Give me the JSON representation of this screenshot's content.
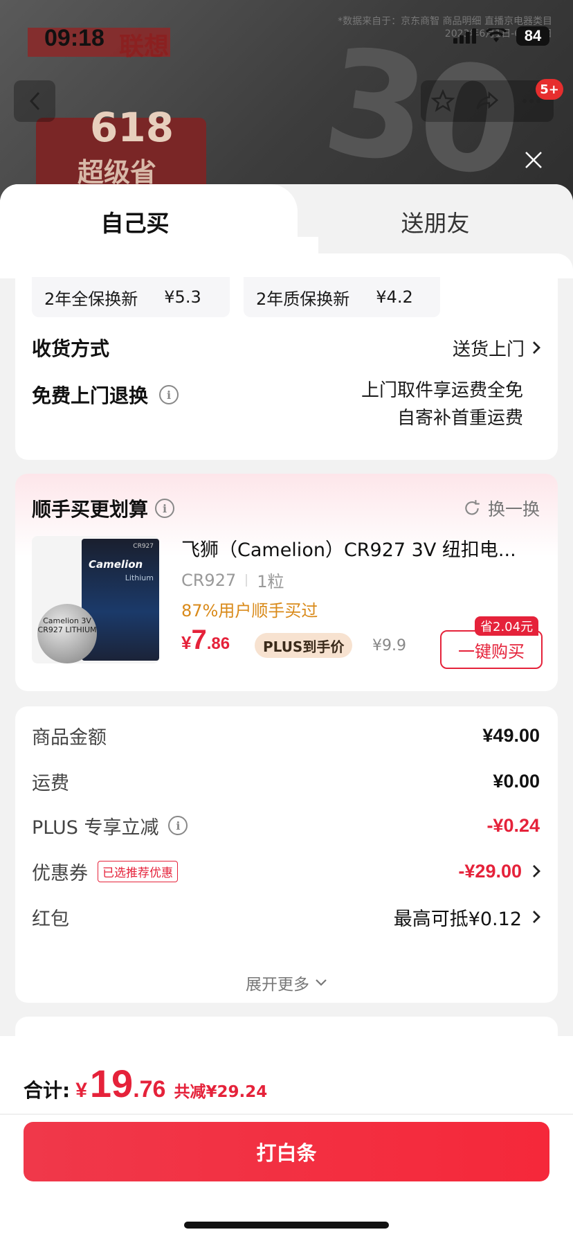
{
  "status_bar": {
    "time": "09:18",
    "battery": "84"
  },
  "background": {
    "brand": "联想",
    "promo_num": "618",
    "promo_text": "超级省",
    "notice_line1": "*数据来自于：京东商智 商品明细 直播京电器类目",
    "notice_line2": "2023年6月1日-6月11日",
    "cart_badge": "5+"
  },
  "tabs": {
    "self_buy": "自己买",
    "gift": "送朋友"
  },
  "warranty": [
    {
      "label": "2年全保换新",
      "price": "¥5.3"
    },
    {
      "label": "2年质保换新",
      "price": "¥4.2"
    }
  ],
  "delivery": {
    "label": "收货方式",
    "value": "送货上门"
  },
  "return": {
    "label": "免费上门退换",
    "line1": "上门取件享运费全免",
    "line2": "自寄补首重运费"
  },
  "addon": {
    "title": "顺手买更划算",
    "swap_label": "换一换",
    "product_title": "飞狮（Camelion）CR927 3V 纽扣电...",
    "spec": "CR927",
    "qty": "1粒",
    "bought_text": "87%用户顺手买过",
    "price_cur": "¥",
    "price_int": "7",
    "price_dec": ".86",
    "plus_tag": "PLUS到手价",
    "original_price": "¥9.9",
    "save_tag": "省2.04元",
    "buy_label": "一键购买",
    "package_brand": "Camelion",
    "package_sub": "Lithium",
    "package_model": "CR927",
    "coin_text": "Camelion 3V CR927 LITHIUM"
  },
  "summary": {
    "goods_amount_label": "商品金额",
    "goods_amount": "¥49.00",
    "shipping_label": "运费",
    "shipping": "¥0.00",
    "plus_label": "PLUS 专享立减",
    "plus_discount": "-¥0.24",
    "coupon_label": "优惠券",
    "coupon_tag": "已选推荐优惠",
    "coupon_value": "-¥29.00",
    "redpacket_label": "红包",
    "redpacket_value": "最高可抵¥0.12",
    "expand_label": "展开更多"
  },
  "footer": {
    "total_label": "合计:",
    "total_cur": "¥",
    "total_int": "19",
    "total_dec": ".76",
    "total_save": "共减¥29.24",
    "pay_button": "打白条"
  },
  "colors": {
    "accent": "#e5223a",
    "page_bg": "#f2f2f2",
    "bought": "#d98a1a"
  }
}
